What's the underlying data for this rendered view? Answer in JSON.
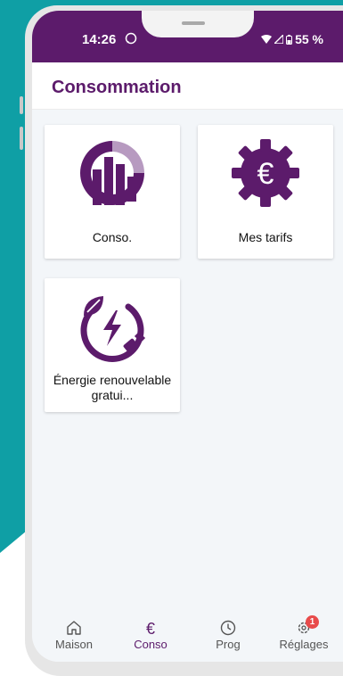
{
  "status_bar": {
    "time": "14:26",
    "battery": "55 %"
  },
  "header": {
    "title": "Consommation"
  },
  "tiles": [
    {
      "label": "Conso.",
      "icon": "bar-chart-icon"
    },
    {
      "label": "Mes tarifs",
      "icon": "euro-gear-icon"
    },
    {
      "label": "Énergie renouvelable gratui...",
      "icon": "green-energy-plug-icon"
    }
  ],
  "bottom_nav": [
    {
      "label": "Maison",
      "icon": "home-icon"
    },
    {
      "label": "Conso",
      "icon": "euro-icon",
      "active": true
    },
    {
      "label": "Prog",
      "icon": "clock-icon"
    },
    {
      "label": "Réglages",
      "icon": "settings-icon",
      "badge": "1"
    }
  ],
  "colors": {
    "brand": "#5c1b6b",
    "accent_light": "#b79ac0",
    "teal": "#0f9fa5",
    "badge": "#e84b4b"
  }
}
